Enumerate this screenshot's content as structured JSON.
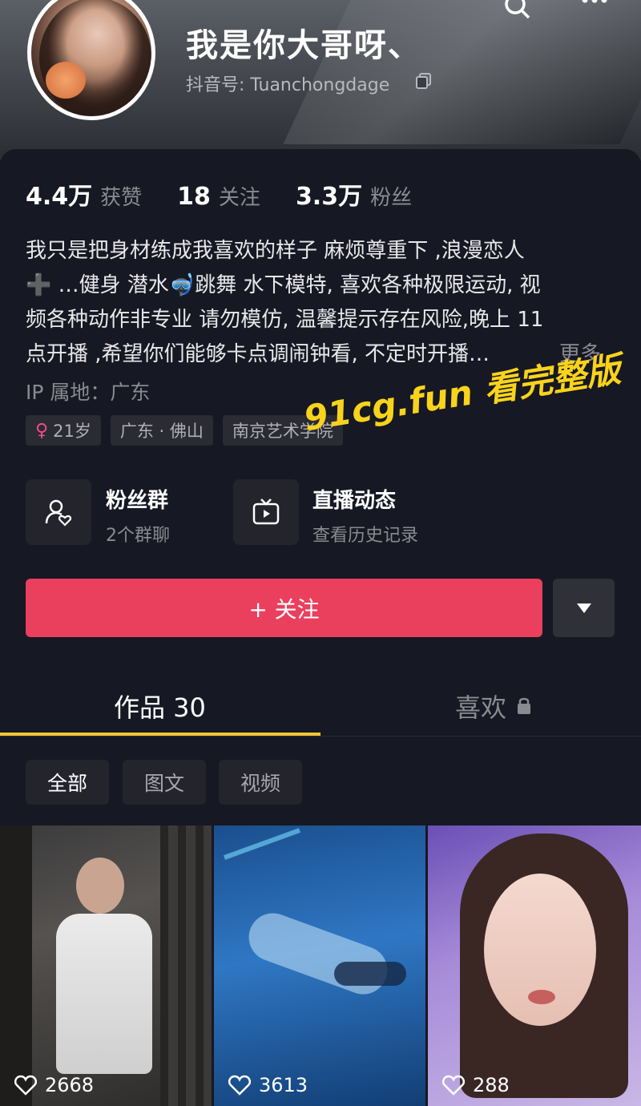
{
  "profile": {
    "nickname": "我是你大哥呀、",
    "douyin_id": "抖音号: Tuanchongdage"
  },
  "stats": [
    {
      "value": "4.4万",
      "label": "获赞"
    },
    {
      "value": "18",
      "label": "关注"
    },
    {
      "value": "3.3万",
      "label": "粉丝"
    }
  ],
  "bio": {
    "line1": "我只是把身材练成我喜欢的样子  麻烦尊重下 ,浪漫恋人",
    "line2": "➕ …健身 潜水🤿跳舞  水下模特, 喜欢各种极限运动, 视",
    "line3": "频各种动作非专业 请勿模仿, 温馨提示存在风险,晚上 11",
    "line4": "点开播 ,希望你们能够卡点调闹钟看,  不定时开播…",
    "more": "更多"
  },
  "ip_location": "IP 属地：广东",
  "tags": {
    "age": "21岁",
    "age_symbol": "♀",
    "location": "广东 · 佛山",
    "school": "南京艺术学院"
  },
  "watermark": "91cg.fun 看完整版",
  "tiles": {
    "fan_group": {
      "title": "粉丝群",
      "subtitle": "2个群聊"
    },
    "live": {
      "title": "直播动态",
      "subtitle": "查看历史记录"
    }
  },
  "follow_button": "+ 关注",
  "tabs": {
    "works": "作品 30",
    "likes": "喜欢"
  },
  "filters": [
    "全部",
    "图文",
    "视频"
  ],
  "videos": [
    {
      "likes": "2668"
    },
    {
      "likes": "3613"
    },
    {
      "likes": "288"
    }
  ],
  "colors": {
    "accent": "#ea3f5d",
    "tab_underline": "#f5c534",
    "watermark": "#f9d31b",
    "background": "#161823"
  }
}
